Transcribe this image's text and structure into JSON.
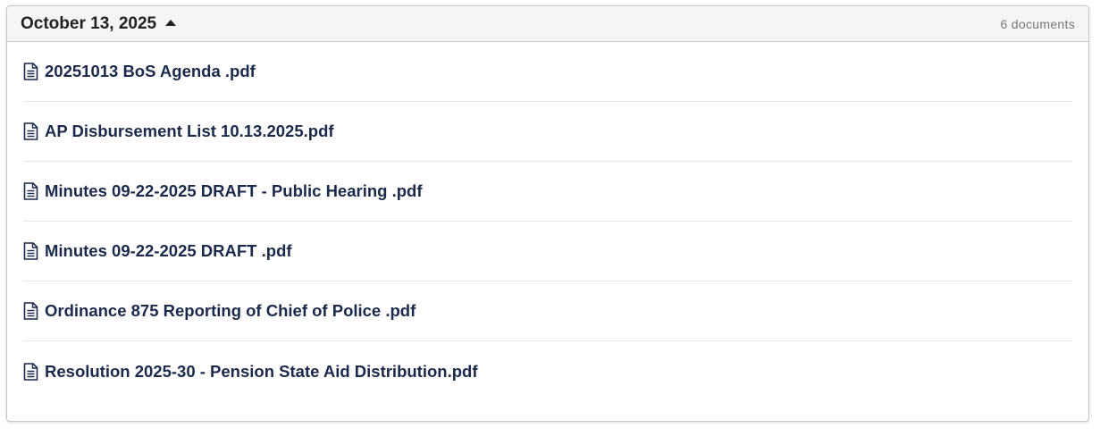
{
  "header": {
    "date": "October 13, 2025",
    "caret_icon": "caret-up-icon",
    "count": "6 documents"
  },
  "documents": [
    {
      "name": "20251013 BoS Agenda .pdf",
      "icon": "document-icon"
    },
    {
      "name": "AP Disbursement List 10.13.2025.pdf",
      "icon": "document-icon"
    },
    {
      "name": "Minutes 09-22-2025 DRAFT - Public Hearing .pdf",
      "icon": "document-icon"
    },
    {
      "name": "Minutes 09-22-2025 DRAFT .pdf",
      "icon": "document-icon"
    },
    {
      "name": "Ordinance 875 Reporting of Chief of Police .pdf",
      "icon": "document-icon"
    },
    {
      "name": "Resolution 2025-30 - Pension State Aid Distribution.pdf",
      "icon": "document-icon"
    }
  ],
  "colors": {
    "link": "#1b2a4a",
    "header_bg": "#f5f5f5",
    "border": "#c8c8c8"
  }
}
